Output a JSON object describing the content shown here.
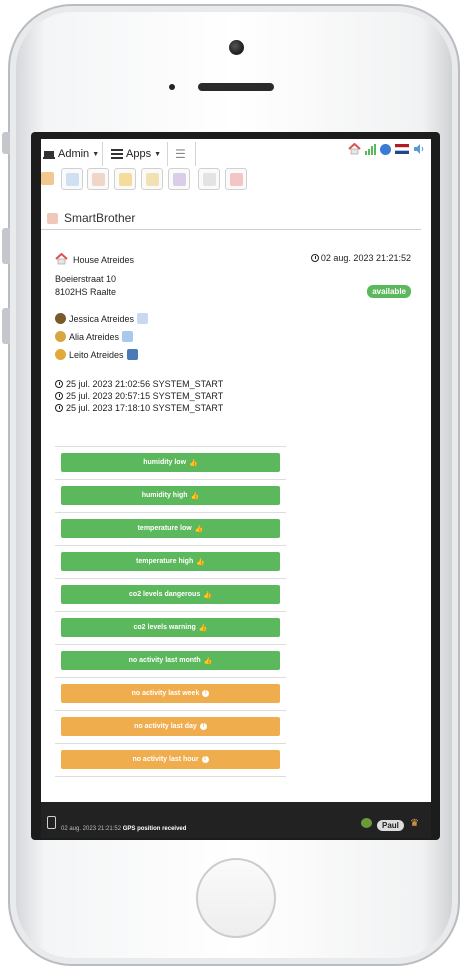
{
  "nav": {
    "admin_label": "Admin",
    "apps_label": "Apps"
  },
  "page": {
    "title": "SmartBrother"
  },
  "house": {
    "name": "House Atreides",
    "street": "Boeierstraat 10",
    "postcode_city": "8102HS Raalte",
    "datetime": "02 aug. 2023 21:21:52",
    "status": "available"
  },
  "persons": [
    {
      "name": "Jessica Atreides"
    },
    {
      "name": "Alia Atreides"
    },
    {
      "name": "Leito Atreides"
    }
  ],
  "log": [
    {
      "text": "25 jul. 2023 21:02:56 SYSTEM_START"
    },
    {
      "text": "25 jul. 2023 20:57:15 SYSTEM_START"
    },
    {
      "text": "25 jul. 2023 17:18:10 SYSTEM_START"
    }
  ],
  "alerts": [
    {
      "label": "humidity low",
      "status": "ok",
      "color": "#5cb85c"
    },
    {
      "label": "humidity high",
      "status": "ok",
      "color": "#5cb85c"
    },
    {
      "label": "temperature low",
      "status": "ok",
      "color": "#5cb85c"
    },
    {
      "label": "temperature high",
      "status": "ok",
      "color": "#5cb85c"
    },
    {
      "label": "co2 levels dangerous",
      "status": "ok",
      "color": "#5cb85c"
    },
    {
      "label": "co2 levels warning",
      "status": "ok",
      "color": "#5cb85c"
    },
    {
      "label": "no activity last month",
      "status": "ok",
      "color": "#5cb85c"
    },
    {
      "label": "no activity last week",
      "status": "warning",
      "color": "#f0ad4e"
    },
    {
      "label": "no activity last day",
      "status": "warning",
      "color": "#f0ad4e"
    },
    {
      "label": "no activity last hour",
      "status": "warning",
      "color": "#f0ad4e"
    }
  ],
  "footer": {
    "datetime": "02 aug. 2023 21:21:52",
    "message": "GPS position received",
    "user": "Paul"
  },
  "colors": {
    "success": "#5cb85c",
    "warning": "#f0ad4e",
    "footer_bg": "#222222"
  }
}
